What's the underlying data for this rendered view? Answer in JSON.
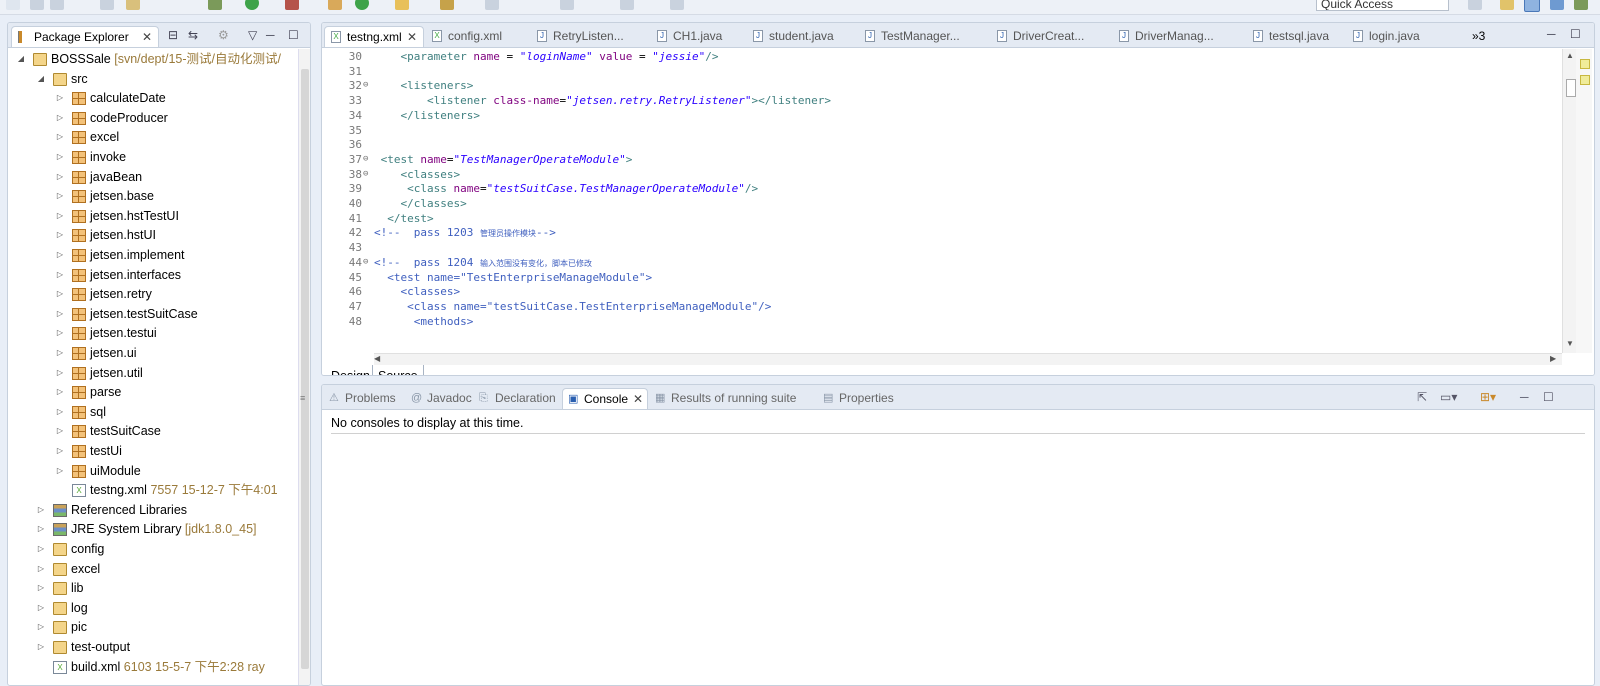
{
  "toolbar": {
    "quick_access_placeholder": "Quick Access"
  },
  "package_explorer": {
    "tab_label": "Package Explorer",
    "tree": [
      {
        "label": "BOSSSale",
        "deco": " [svn/dept/15-测试/自动化测试/",
        "depth": 0,
        "icon": "project-icon",
        "twisty": "open"
      },
      {
        "label": "src",
        "deco": "",
        "depth": 1,
        "icon": "source-folder-icon",
        "twisty": "open"
      },
      {
        "label": "calculateDate",
        "deco": "",
        "depth": 2,
        "icon": "package-icon",
        "twisty": "closed"
      },
      {
        "label": "codeProducer",
        "deco": "",
        "depth": 2,
        "icon": "package-icon",
        "twisty": "closed"
      },
      {
        "label": "excel",
        "deco": "",
        "depth": 2,
        "icon": "package-icon",
        "twisty": "closed"
      },
      {
        "label": "invoke",
        "deco": "",
        "depth": 2,
        "icon": "package-icon",
        "twisty": "closed"
      },
      {
        "label": "javaBean",
        "deco": "",
        "depth": 2,
        "icon": "package-icon",
        "twisty": "closed"
      },
      {
        "label": "jetsen.base",
        "deco": "",
        "depth": 2,
        "icon": "package-icon",
        "twisty": "closed"
      },
      {
        "label": "jetsen.hstTestUI",
        "deco": "",
        "depth": 2,
        "icon": "package-icon",
        "twisty": "closed"
      },
      {
        "label": "jetsen.hstUI",
        "deco": "",
        "depth": 2,
        "icon": "package-icon",
        "twisty": "closed"
      },
      {
        "label": "jetsen.implement",
        "deco": "",
        "depth": 2,
        "icon": "package-icon",
        "twisty": "closed"
      },
      {
        "label": "jetsen.interfaces",
        "deco": "",
        "depth": 2,
        "icon": "package-icon",
        "twisty": "closed"
      },
      {
        "label": "jetsen.retry",
        "deco": "",
        "depth": 2,
        "icon": "package-icon",
        "twisty": "closed"
      },
      {
        "label": "jetsen.testSuitCase",
        "deco": "",
        "depth": 2,
        "icon": "package-icon",
        "twisty": "closed"
      },
      {
        "label": "jetsen.testui",
        "deco": "",
        "depth": 2,
        "icon": "package-icon",
        "twisty": "closed"
      },
      {
        "label": "jetsen.ui",
        "deco": "",
        "depth": 2,
        "icon": "package-icon",
        "twisty": "closed"
      },
      {
        "label": "jetsen.util",
        "deco": "",
        "depth": 2,
        "icon": "package-icon",
        "twisty": "closed"
      },
      {
        "label": "parse",
        "deco": "",
        "depth": 2,
        "icon": "package-icon",
        "twisty": "closed"
      },
      {
        "label": "sql",
        "deco": "",
        "depth": 2,
        "icon": "package-icon",
        "twisty": "closed"
      },
      {
        "label": "testSuitCase",
        "deco": "",
        "depth": 2,
        "icon": "package-icon",
        "twisty": "closed"
      },
      {
        "label": "testUi",
        "deco": "",
        "depth": 2,
        "icon": "package-icon",
        "twisty": "closed"
      },
      {
        "label": "uiModule",
        "deco": "",
        "depth": 2,
        "icon": "package-icon",
        "twisty": "closed"
      },
      {
        "label": "testng.xml",
        "deco": " 7557  15-12-7 下午4:01",
        "depth": 2,
        "icon": "xml-file-icon",
        "twisty": "none"
      },
      {
        "label": "Referenced Libraries",
        "deco": "",
        "depth": 1,
        "icon": "library-icon",
        "twisty": "closed"
      },
      {
        "label": "JRE System Library",
        "deco": " [jdk1.8.0_45]",
        "depth": 1,
        "icon": "library-icon",
        "twisty": "closed"
      },
      {
        "label": "config",
        "deco": "",
        "depth": 1,
        "icon": "folder-icon",
        "twisty": "closed"
      },
      {
        "label": "excel",
        "deco": "",
        "depth": 1,
        "icon": "folder-icon",
        "twisty": "closed"
      },
      {
        "label": "lib",
        "deco": "",
        "depth": 1,
        "icon": "folder-icon",
        "twisty": "closed"
      },
      {
        "label": "log",
        "deco": "",
        "depth": 1,
        "icon": "folder-icon",
        "twisty": "closed"
      },
      {
        "label": "pic",
        "deco": "",
        "depth": 1,
        "icon": "folder-icon",
        "twisty": "closed"
      },
      {
        "label": "test-output",
        "deco": "",
        "depth": 1,
        "icon": "folder-icon",
        "twisty": "closed"
      },
      {
        "label": "build.xml",
        "deco": " 6103  15-5-7 下午2:28  ray",
        "depth": 1,
        "icon": "xml-file-icon",
        "twisty": "none"
      }
    ]
  },
  "editor": {
    "tabs": [
      {
        "label": "testng.xml",
        "kind": "xml",
        "active": true
      },
      {
        "label": "config.xml",
        "kind": "xml",
        "active": false
      },
      {
        "label": "RetryListen...",
        "kind": "java",
        "active": false
      },
      {
        "label": "CH1.java",
        "kind": "java",
        "active": false
      },
      {
        "label": "student.java",
        "kind": "java",
        "active": false
      },
      {
        "label": "TestManager...",
        "kind": "java",
        "active": false
      },
      {
        "label": "DriverCreat...",
        "kind": "java",
        "active": false
      },
      {
        "label": "DriverManag...",
        "kind": "java",
        "active": false
      },
      {
        "label": "testsql.java",
        "kind": "java",
        "active": false
      },
      {
        "label": "login.java",
        "kind": "java",
        "active": false
      }
    ],
    "overflow_label": "»3",
    "lines": [
      {
        "n": "30",
        "fold": "",
        "html": "    <span class=\"tag\">&lt;parameter</span> <span class=\"attr\">name</span> = <span class=\"val\">\"loginName\"</span> <span class=\"attr\">value</span> = <span class=\"val\">\"jessie\"</span><span class=\"tag\">/&gt;</span>"
      },
      {
        "n": "31",
        "fold": "",
        "html": ""
      },
      {
        "n": "32",
        "fold": "⊖",
        "html": "    <span class=\"tag\">&lt;listeners&gt;</span>"
      },
      {
        "n": "33",
        "fold": "",
        "html": "        <span class=\"tag\">&lt;listener</span> <span class=\"attr\">class-name</span>=<span class=\"val\">\"jetsen.retry.RetryListener\"</span><span class=\"tag\">&gt;&lt;/listener&gt;</span>"
      },
      {
        "n": "34",
        "fold": "",
        "html": "    <span class=\"tag\">&lt;/listeners&gt;</span>"
      },
      {
        "n": "35",
        "fold": "",
        "html": ""
      },
      {
        "n": "36",
        "fold": "",
        "html": ""
      },
      {
        "n": "37",
        "fold": "⊖",
        "html": " <span class=\"tag\">&lt;test</span> <span class=\"attr\">name</span>=<span class=\"val\">\"TestManagerOperateModule\"</span><span class=\"tag\">&gt;</span>"
      },
      {
        "n": "38",
        "fold": "⊖",
        "html": "    <span class=\"tag\">&lt;classes&gt;</span>"
      },
      {
        "n": "39",
        "fold": "",
        "html": "     <span class=\"tag\">&lt;class</span> <span class=\"attr\">name</span>=<span class=\"val\">\"testSuitCase.TestManagerOperateModule\"</span><span class=\"tag\">/&gt;</span>"
      },
      {
        "n": "40",
        "fold": "",
        "html": "    <span class=\"tag\">&lt;/classes&gt;</span>"
      },
      {
        "n": "41",
        "fold": "",
        "html": "  <span class=\"tag\">&lt;/test&gt;</span>"
      },
      {
        "n": "42",
        "fold": "",
        "html": "<span class=\"cmt\">&lt;!--  pass 1203 <span class=\"cn\">管理员操作模块</span>--&gt;</span>"
      },
      {
        "n": "43",
        "fold": "",
        "html": ""
      },
      {
        "n": "44",
        "fold": "⊖",
        "html": "<span class=\"cmt\">&lt;!--  pass 1204 <span class=\"cn\">输入范围没有变化，脚本已修改</span></span>"
      },
      {
        "n": "45",
        "fold": "",
        "html": "  <span class=\"cmt\">&lt;test name=\"TestEnterpriseManageModule\"&gt;</span>"
      },
      {
        "n": "46",
        "fold": "",
        "html": "    <span class=\"cmt\">&lt;classes&gt;</span>"
      },
      {
        "n": "47",
        "fold": "",
        "html": "     <span class=\"cmt\">&lt;class name=\"testSuitCase.TestEnterpriseManageModule\"/&gt;</span>"
      },
      {
        "n": "48",
        "fold": "",
        "html": "      <span class=\"cmt\">&lt;methods&gt;</span>"
      }
    ],
    "mode_tabs": [
      {
        "label": "Design",
        "selected": true
      },
      {
        "label": "Source",
        "selected": false
      }
    ]
  },
  "console": {
    "tabs": [
      {
        "label": "Problems",
        "active": false
      },
      {
        "label": "Javadoc",
        "active": false
      },
      {
        "label": "Declaration",
        "active": false
      },
      {
        "label": "Console",
        "active": true
      },
      {
        "label": "Results of running suite",
        "active": false
      },
      {
        "label": "Properties",
        "active": false
      }
    ],
    "message": "No consoles to display at this time."
  }
}
